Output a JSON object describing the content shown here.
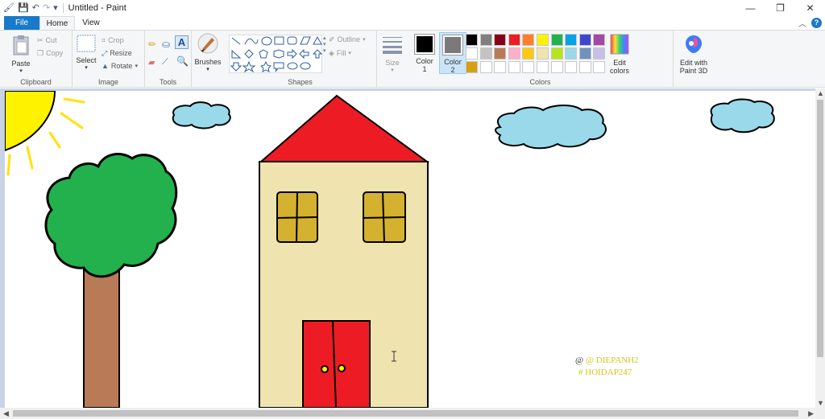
{
  "window": {
    "title": "Untitled - Paint",
    "controls": {
      "minimize": "—",
      "maximize": "❐",
      "close": "✕"
    }
  },
  "quick_access": {
    "save_icon": "save-icon",
    "undo_icon": "undo-icon",
    "redo_icon": "redo-icon",
    "customize_icon": "dropdown-icon"
  },
  "tabs": {
    "file": "File",
    "home": "Home",
    "view": "View"
  },
  "ribbon": {
    "clipboard": {
      "label": "Clipboard",
      "paste": "Paste",
      "cut": "Cut",
      "copy": "Copy"
    },
    "image": {
      "label": "Image",
      "select": "Select",
      "crop": "Crop",
      "resize": "Resize",
      "rotate": "Rotate"
    },
    "tools": {
      "label": "Tools"
    },
    "brushes": {
      "label": "Brushes"
    },
    "shapes": {
      "label": "Shapes",
      "outline": "Outline",
      "fill": "Fill"
    },
    "size": {
      "label": "Size"
    },
    "colors": {
      "label": "Colors",
      "color1_label": "Color 1",
      "color2_label": "Color 2",
      "color1": "#000000",
      "color2": "#ffffff",
      "palette_row1": [
        "#000000",
        "#7f7f7f",
        "#880015",
        "#ed1c24",
        "#ff7f27",
        "#fff200",
        "#22b14c",
        "#00a2e8",
        "#3f48cc",
        "#a349a4"
      ],
      "palette_row2": [
        "#ffffff",
        "#c3c3c3",
        "#b97a57",
        "#ffaec9",
        "#ffc90e",
        "#efe4b0",
        "#b5e61d",
        "#99d9ea",
        "#7092be",
        "#c8bfe7"
      ],
      "palette_row3": [
        "#d4a017",
        "#ffffff",
        "#ffffff",
        "#ffffff",
        "#ffffff",
        "#ffffff",
        "#ffffff",
        "#ffffff",
        "#ffffff",
        "#ffffff"
      ],
      "edit_colors": "Edit colors",
      "edit_paint3d": "Edit with Paint 3D"
    }
  },
  "canvas": {
    "signature_line1": "@ DIEPANH2",
    "signature_line2": "# HOIDAP247",
    "colors": {
      "sun": "#fff200",
      "tree_leaves": "#22b14c",
      "trunk": "#b97a57",
      "roof": "#ed1c24",
      "wall": "#efe4b0",
      "door": "#ed1c24",
      "window": "#d4b12f",
      "cloud": "#99d9ea"
    }
  },
  "cursor": "text-cursor-icon"
}
